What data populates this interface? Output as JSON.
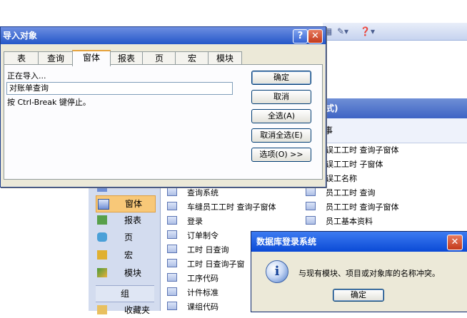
{
  "toolbar": {
    "icons": [
      "table-view-icon",
      "dropdown-icon",
      "help-icon"
    ]
  },
  "main_window": {
    "header_text": "式)",
    "sub_text": "事",
    "object_bar": [
      {
        "label": "",
        "icon": "table-icon",
        "selected": false
      },
      {
        "label": "窗体",
        "icon": "form-icon",
        "selected": true
      },
      {
        "label": "报表",
        "icon": "report-icon",
        "selected": false
      },
      {
        "label": "页",
        "icon": "page-icon",
        "selected": false
      },
      {
        "label": "宏",
        "icon": "macro-icon",
        "selected": false
      },
      {
        "label": "模块",
        "icon": "module-icon",
        "selected": false
      },
      {
        "label": "组",
        "icon": "",
        "selected": false
      },
      {
        "label": "收藏夹",
        "icon": "favorites-icon",
        "selected": false
      }
    ],
    "list_col1": [
      "查询系统",
      "车缝员工工时 查询子窗体",
      "登录",
      "订单制令",
      "工时 日查询",
      "工时 日查询子窗",
      "工序代码",
      "计件标准",
      "课组代码"
    ],
    "list_col2": [
      "误工工时 查询子窗体",
      "误工工时 子窗体",
      "误工名称",
      "员工工时 查询",
      "员工工时 查询子窗体",
      "员工基本资料"
    ]
  },
  "import_dialog": {
    "title": "导入对象",
    "help_btn": "?",
    "close_btn": "✕",
    "tabs": [
      "表",
      "查询",
      "窗体",
      "报表",
      "页",
      "宏",
      "模块"
    ],
    "selected_tab": 2,
    "status_text": "正在导入...",
    "current_object": "对账单查询",
    "hint": "按 Ctrl-Break 键停止。",
    "buttons": {
      "ok": "确定",
      "cancel": "取消",
      "select_all": "全选(A)",
      "deselect_all": "取消全选(E)",
      "options": "选项(O) >>"
    }
  },
  "message_box": {
    "title": "数据库登录系统",
    "close_btn": "✕",
    "icon": "info-icon",
    "message": "与现有模块、项目或对象库的名称冲突。",
    "ok": "确定"
  }
}
